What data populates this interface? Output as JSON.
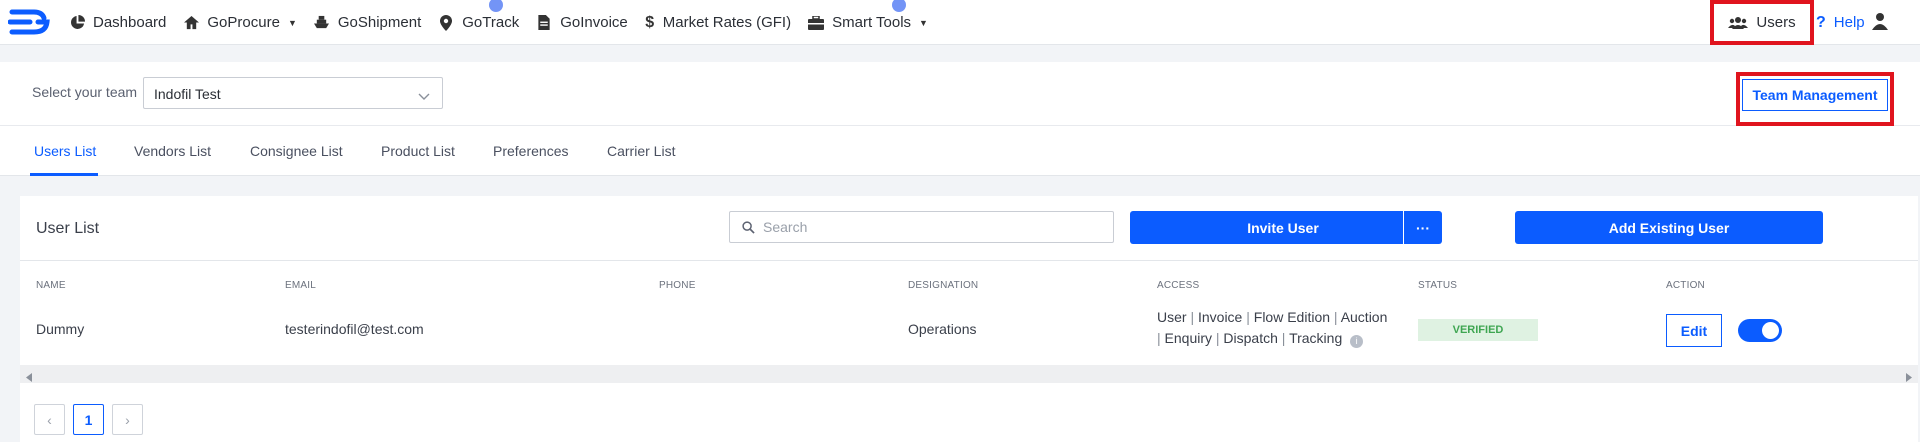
{
  "nav": {
    "items": [
      {
        "label": "Dashboard",
        "icon": "pie-chart-icon",
        "caret": false
      },
      {
        "label": "GoProcure",
        "icon": "home-icon",
        "caret": true
      },
      {
        "label": "GoShipment",
        "icon": "ship-icon",
        "caret": false
      },
      {
        "label": "GoTrack",
        "icon": "location-pin-icon",
        "caret": false
      },
      {
        "label": "GoInvoice",
        "icon": "invoice-icon",
        "caret": false
      },
      {
        "label": "Market Rates (GFI)",
        "icon": "dollar-icon",
        "caret": false
      },
      {
        "label": "Smart Tools",
        "icon": "toolbox-icon",
        "caret": true
      }
    ],
    "users_label": "Users",
    "help_label": "Help"
  },
  "team": {
    "label": "Select your team",
    "selected": "Indofil Test",
    "management_button": "Team Management"
  },
  "tabs": [
    "Users List",
    "Vendors List",
    "Consignee List",
    "Product List",
    "Preferences",
    "Carrier List"
  ],
  "active_tab": "Users List",
  "list": {
    "title": "User List",
    "search_placeholder": "Search",
    "invite_button": "Invite User",
    "invite_more": "···",
    "add_existing_button": "Add Existing User",
    "columns": [
      "NAME",
      "EMAIL",
      "PHONE",
      "DESIGNATION",
      "ACCESS",
      "STATUS",
      "ACTION"
    ],
    "rows": [
      {
        "name": "Dummy",
        "email": "testerindofil@test.com",
        "phone": "",
        "designation": "Operations",
        "access_line1": [
          "User",
          "Invoice",
          "Flow Edition",
          "Auction"
        ],
        "access_line2": [
          "Enquiry",
          "Dispatch",
          "Tracking"
        ],
        "status": "VERIFIED",
        "action_label": "Edit",
        "enabled": true
      }
    ]
  },
  "pagination": {
    "current": "1",
    "prev": "‹",
    "next": "›"
  },
  "colors": {
    "accent": "#0b5cff",
    "highlight": "#e0141e",
    "verified_bg": "#dff2e2",
    "verified_text": "#3fa652"
  }
}
